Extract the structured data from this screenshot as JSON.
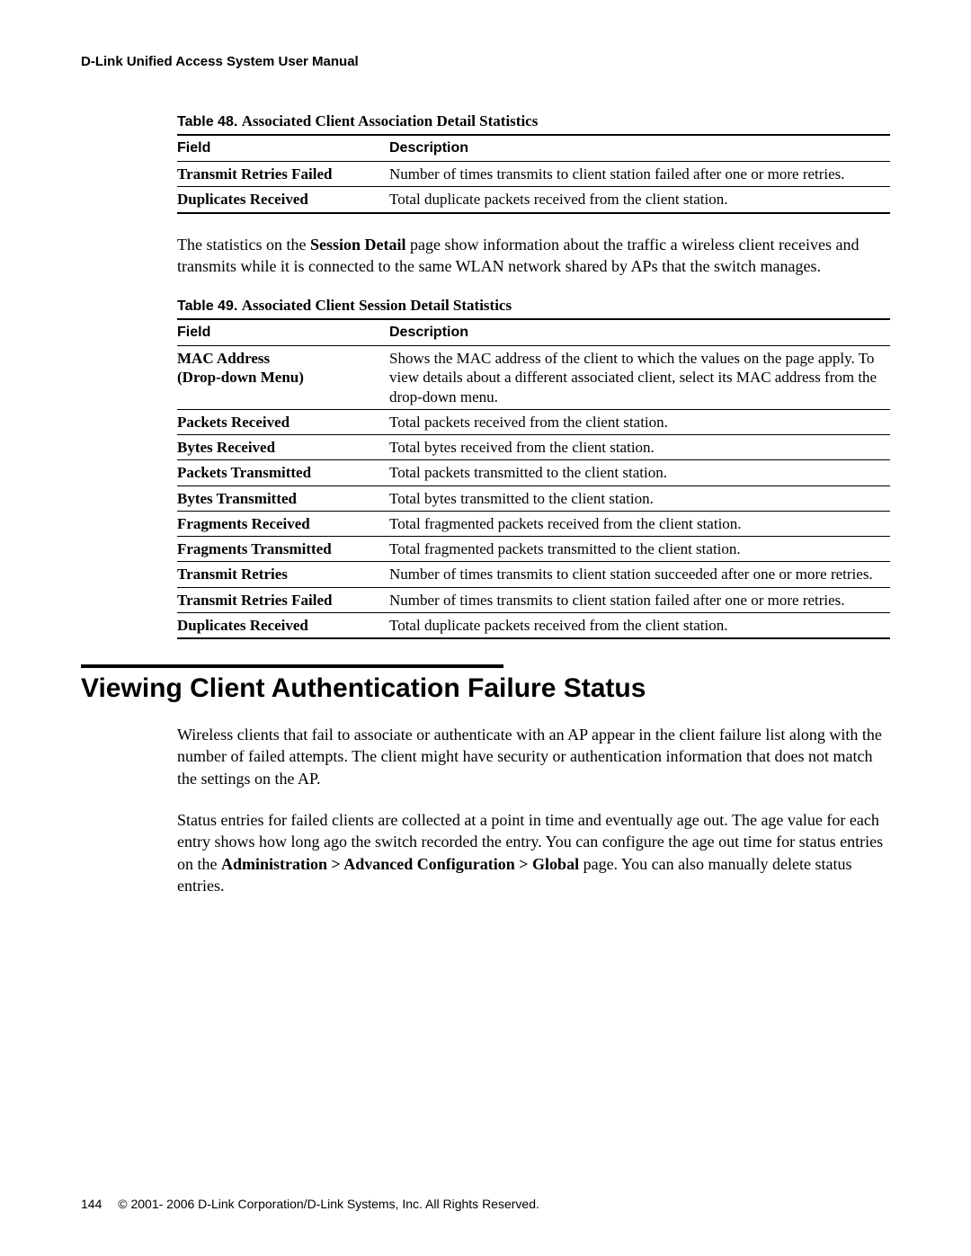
{
  "header": "D-Link Unified Access System User Manual",
  "table48": {
    "caption_prefix": "Table 48.",
    "caption_title": "Associated Client Association Detail Statistics",
    "col_field": "Field",
    "col_desc": "Description",
    "rows": [
      {
        "field": "Transmit Retries Failed",
        "desc": "Number of times transmits to client station failed after one or more retries."
      },
      {
        "field": "Duplicates Received",
        "desc": "Total duplicate packets received from the client station."
      }
    ]
  },
  "para1": {
    "pre": "The statistics on the ",
    "bold": "Session Detail",
    "post": " page show information about the traffic a wireless client receives and transmits while it is connected to the same WLAN network shared by APs that the switch manages."
  },
  "table49": {
    "caption_prefix": "Table 49.",
    "caption_title": "Associated Client Session Detail Statistics",
    "col_field": "Field",
    "col_desc": "Description",
    "rows": [
      {
        "field": "MAC Address\n(Drop-down Menu)",
        "desc": "Shows the MAC address of the client to which the values on the page apply. To view details about a different associated client, select its MAC address from the drop-down menu."
      },
      {
        "field": "Packets Received",
        "desc": "Total packets received from the client station."
      },
      {
        "field": "Bytes Received",
        "desc": "Total bytes received from the client station."
      },
      {
        "field": "Packets Transmitted",
        "desc": "Total packets transmitted to the client station."
      },
      {
        "field": "Bytes Transmitted",
        "desc": "Total bytes transmitted to the client station."
      },
      {
        "field": "Fragments Received",
        "desc": "Total fragmented packets received from the client station."
      },
      {
        "field": "Fragments Transmitted",
        "desc": "Total fragmented packets transmitted to the client station."
      },
      {
        "field": "Transmit Retries",
        "desc": "Number of times transmits to client station succeeded after one or more retries."
      },
      {
        "field": "Transmit Retries Failed",
        "desc": "Number of times transmits to client station failed after one or more retries."
      },
      {
        "field": "Duplicates Received",
        "desc": "Total duplicate packets received from the client station."
      }
    ]
  },
  "section": {
    "title": "Viewing Client Authentication Failure Status",
    "p1": "Wireless clients that fail to associate or authenticate with an AP appear in the client failure list along with the number of failed attempts. The client might have security or authentication information that does not match the settings on the AP.",
    "p2_pre": "Status entries for failed clients are collected at a point in time and eventually age out. The age value for each entry shows how long ago the switch recorded the entry. You can configure the age out time for status entries on the ",
    "p2_bold": "Administration > Advanced Configuration > Global",
    "p2_post": " page. You can also manually delete status entries."
  },
  "footer": {
    "page": "144",
    "copyright": "© 2001- 2006 D-Link Corporation/D-Link Systems, Inc. All Rights Reserved."
  }
}
